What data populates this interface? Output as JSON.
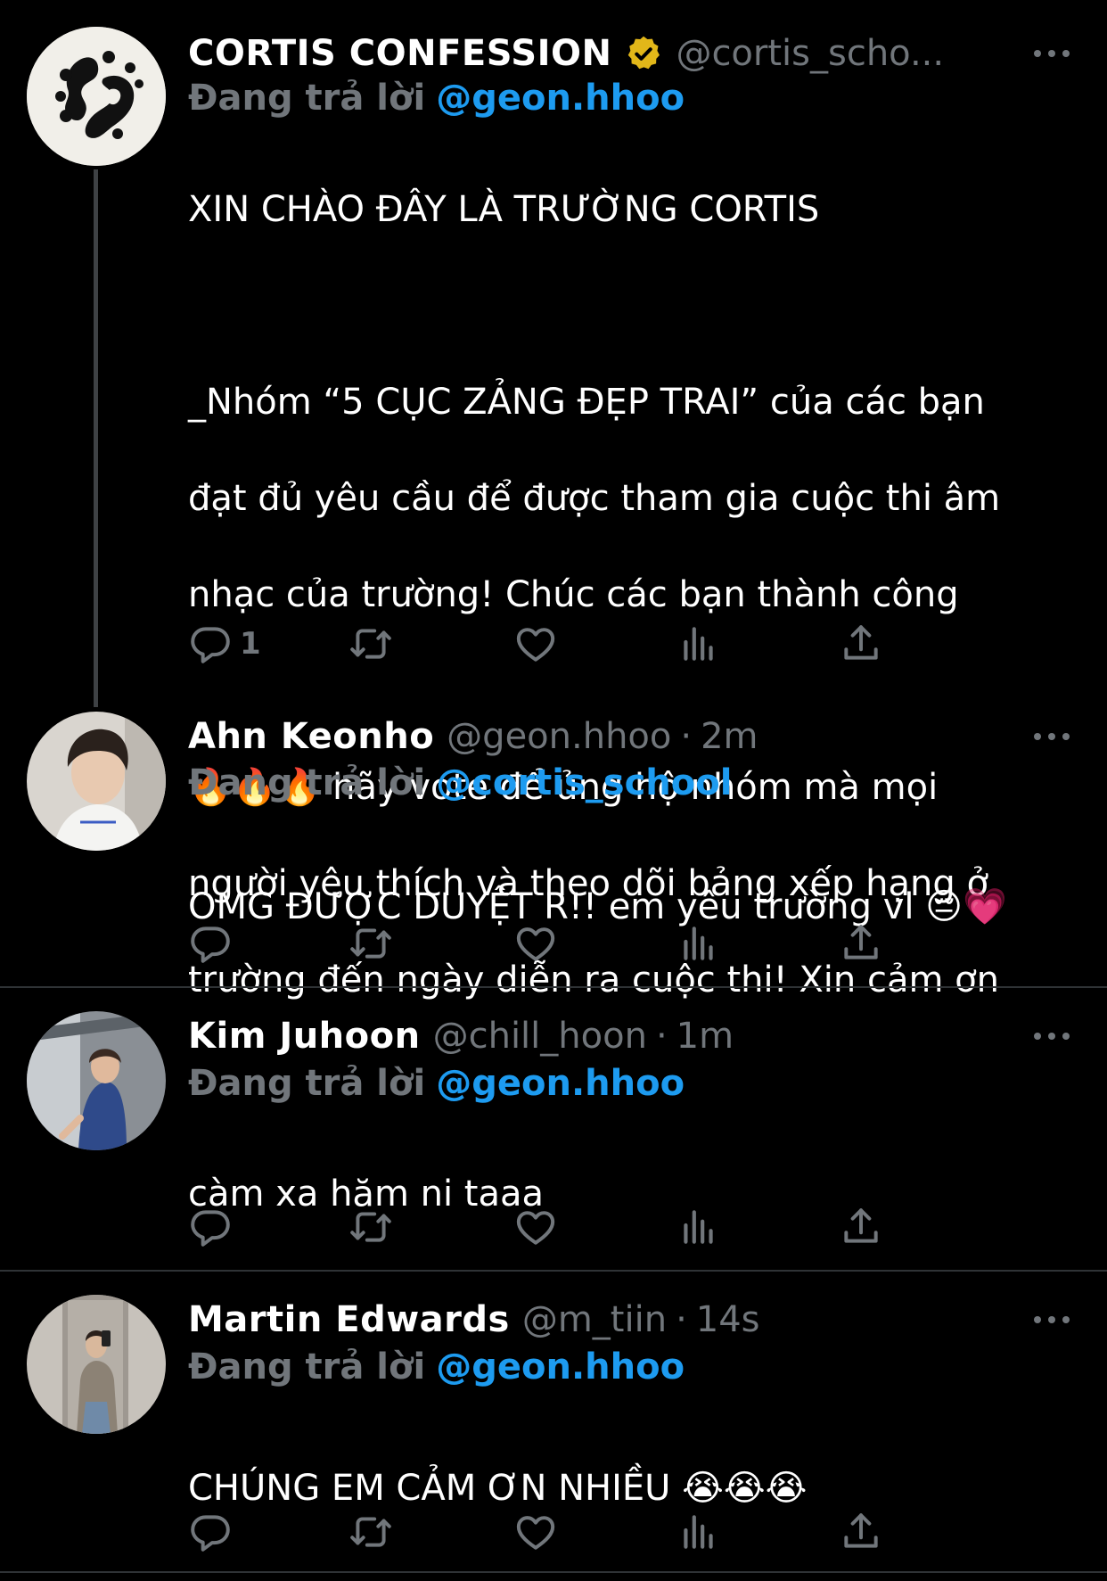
{
  "colors": {
    "background": "#000000",
    "text": "#ffffff",
    "muted": "#71767b",
    "link": "#1d9bf0",
    "verified": "#e2b719",
    "separator": "#2f3336"
  },
  "reply_prefix": "Đang trả lời",
  "tweets": [
    {
      "name": "CORTIS CONFESSION",
      "verified": true,
      "handle": "@cortis_scho...",
      "time": "",
      "reply_to": "@geon.hhoo",
      "avatar_icon": "cortis-logo-avatar",
      "lines": [
        "XIN CHÀO ĐÂY LÀ TRƯỜNG CORTIS",
        "",
        "_Nhóm “5 CỤC ZẢNG ĐẸP TRAI” của các bạn",
        "đạt đủ yêu cầu để được tham gia cuộc thi âm",
        "nhạc của trường! Chúc các bạn thành công",
        "",
        "🔥🔥🔥 hãy vote để ủng hộ nhóm mà mọi",
        "người yêu thích và theo dõi bảng xếp hạng ở",
        "trường đến ngày diễn ra cuộc thi! Xin cảm ơn"
      ],
      "reply_count": "1"
    },
    {
      "name": "Ahn Keonho",
      "verified": false,
      "handle": "@geon.hhoo",
      "time": "2m",
      "reply_to": "@cortis_school",
      "avatar_icon": "photo-avatar",
      "lines": [
        "OMG ĐƯỢC DUYỆT R!! em yêu trường vl 😔💗"
      ],
      "reply_count": ""
    },
    {
      "name": "Kim Juhoon",
      "verified": false,
      "handle": "@chill_hoon",
      "time": "1m",
      "reply_to": "@geon.hhoo",
      "avatar_icon": "photo-avatar",
      "lines": [
        "càm xa hăm ni taaa"
      ],
      "reply_count": ""
    },
    {
      "name": "Martin Edwards",
      "verified": false,
      "handle": "@m_tiin",
      "time": "14s",
      "reply_to": "@geon.hhoo",
      "avatar_icon": "photo-avatar",
      "lines": [
        "CHÚNG EM CẢM ƠN NHIỀU 😭😭😭"
      ],
      "reply_count": ""
    }
  ],
  "actions": [
    "reply-icon",
    "retweet-icon",
    "like-icon",
    "views-icon",
    "share-icon"
  ]
}
